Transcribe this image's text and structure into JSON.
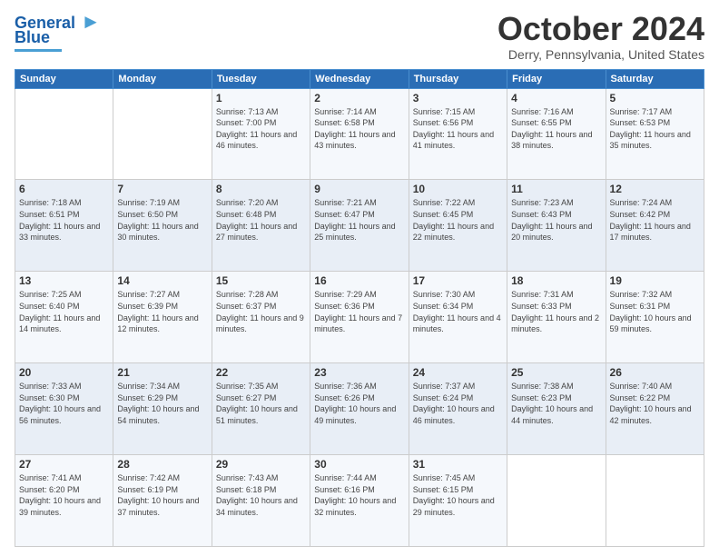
{
  "header": {
    "logo_line1": "General",
    "logo_line2": "Blue",
    "month_title": "October 2024",
    "location": "Derry, Pennsylvania, United States"
  },
  "weekdays": [
    "Sunday",
    "Monday",
    "Tuesday",
    "Wednesday",
    "Thursday",
    "Friday",
    "Saturday"
  ],
  "weeks": [
    [
      {
        "day": "",
        "info": ""
      },
      {
        "day": "",
        "info": ""
      },
      {
        "day": "1",
        "info": "Sunrise: 7:13 AM\nSunset: 7:00 PM\nDaylight: 11 hours and 46 minutes."
      },
      {
        "day": "2",
        "info": "Sunrise: 7:14 AM\nSunset: 6:58 PM\nDaylight: 11 hours and 43 minutes."
      },
      {
        "day": "3",
        "info": "Sunrise: 7:15 AM\nSunset: 6:56 PM\nDaylight: 11 hours and 41 minutes."
      },
      {
        "day": "4",
        "info": "Sunrise: 7:16 AM\nSunset: 6:55 PM\nDaylight: 11 hours and 38 minutes."
      },
      {
        "day": "5",
        "info": "Sunrise: 7:17 AM\nSunset: 6:53 PM\nDaylight: 11 hours and 35 minutes."
      }
    ],
    [
      {
        "day": "6",
        "info": "Sunrise: 7:18 AM\nSunset: 6:51 PM\nDaylight: 11 hours and 33 minutes."
      },
      {
        "day": "7",
        "info": "Sunrise: 7:19 AM\nSunset: 6:50 PM\nDaylight: 11 hours and 30 minutes."
      },
      {
        "day": "8",
        "info": "Sunrise: 7:20 AM\nSunset: 6:48 PM\nDaylight: 11 hours and 27 minutes."
      },
      {
        "day": "9",
        "info": "Sunrise: 7:21 AM\nSunset: 6:47 PM\nDaylight: 11 hours and 25 minutes."
      },
      {
        "day": "10",
        "info": "Sunrise: 7:22 AM\nSunset: 6:45 PM\nDaylight: 11 hours and 22 minutes."
      },
      {
        "day": "11",
        "info": "Sunrise: 7:23 AM\nSunset: 6:43 PM\nDaylight: 11 hours and 20 minutes."
      },
      {
        "day": "12",
        "info": "Sunrise: 7:24 AM\nSunset: 6:42 PM\nDaylight: 11 hours and 17 minutes."
      }
    ],
    [
      {
        "day": "13",
        "info": "Sunrise: 7:25 AM\nSunset: 6:40 PM\nDaylight: 11 hours and 14 minutes."
      },
      {
        "day": "14",
        "info": "Sunrise: 7:27 AM\nSunset: 6:39 PM\nDaylight: 11 hours and 12 minutes."
      },
      {
        "day": "15",
        "info": "Sunrise: 7:28 AM\nSunset: 6:37 PM\nDaylight: 11 hours and 9 minutes."
      },
      {
        "day": "16",
        "info": "Sunrise: 7:29 AM\nSunset: 6:36 PM\nDaylight: 11 hours and 7 minutes."
      },
      {
        "day": "17",
        "info": "Sunrise: 7:30 AM\nSunset: 6:34 PM\nDaylight: 11 hours and 4 minutes."
      },
      {
        "day": "18",
        "info": "Sunrise: 7:31 AM\nSunset: 6:33 PM\nDaylight: 11 hours and 2 minutes."
      },
      {
        "day": "19",
        "info": "Sunrise: 7:32 AM\nSunset: 6:31 PM\nDaylight: 10 hours and 59 minutes."
      }
    ],
    [
      {
        "day": "20",
        "info": "Sunrise: 7:33 AM\nSunset: 6:30 PM\nDaylight: 10 hours and 56 minutes."
      },
      {
        "day": "21",
        "info": "Sunrise: 7:34 AM\nSunset: 6:29 PM\nDaylight: 10 hours and 54 minutes."
      },
      {
        "day": "22",
        "info": "Sunrise: 7:35 AM\nSunset: 6:27 PM\nDaylight: 10 hours and 51 minutes."
      },
      {
        "day": "23",
        "info": "Sunrise: 7:36 AM\nSunset: 6:26 PM\nDaylight: 10 hours and 49 minutes."
      },
      {
        "day": "24",
        "info": "Sunrise: 7:37 AM\nSunset: 6:24 PM\nDaylight: 10 hours and 46 minutes."
      },
      {
        "day": "25",
        "info": "Sunrise: 7:38 AM\nSunset: 6:23 PM\nDaylight: 10 hours and 44 minutes."
      },
      {
        "day": "26",
        "info": "Sunrise: 7:40 AM\nSunset: 6:22 PM\nDaylight: 10 hours and 42 minutes."
      }
    ],
    [
      {
        "day": "27",
        "info": "Sunrise: 7:41 AM\nSunset: 6:20 PM\nDaylight: 10 hours and 39 minutes."
      },
      {
        "day": "28",
        "info": "Sunrise: 7:42 AM\nSunset: 6:19 PM\nDaylight: 10 hours and 37 minutes."
      },
      {
        "day": "29",
        "info": "Sunrise: 7:43 AM\nSunset: 6:18 PM\nDaylight: 10 hours and 34 minutes."
      },
      {
        "day": "30",
        "info": "Sunrise: 7:44 AM\nSunset: 6:16 PM\nDaylight: 10 hours and 32 minutes."
      },
      {
        "day": "31",
        "info": "Sunrise: 7:45 AM\nSunset: 6:15 PM\nDaylight: 10 hours and 29 minutes."
      },
      {
        "day": "",
        "info": ""
      },
      {
        "day": "",
        "info": ""
      }
    ]
  ]
}
